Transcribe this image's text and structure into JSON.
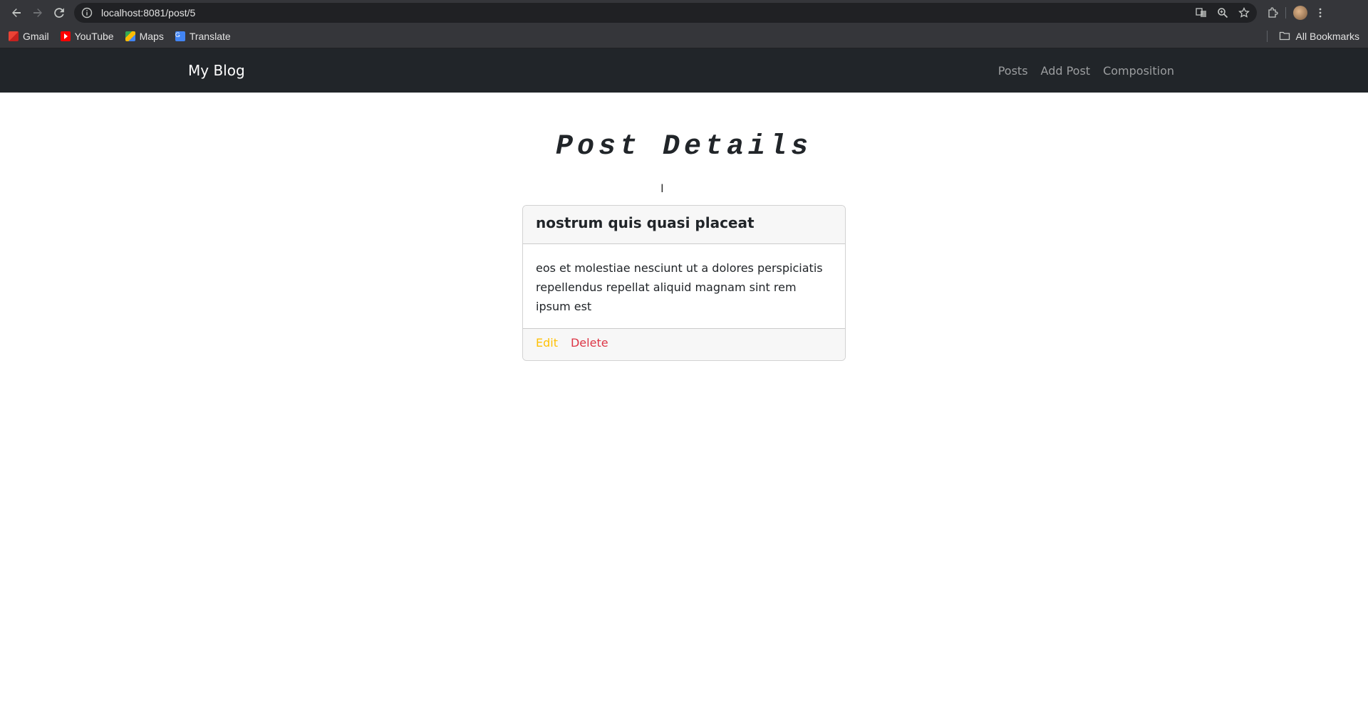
{
  "browser": {
    "url": "localhost:8081/post/5",
    "bookmarks": [
      {
        "label": "Gmail",
        "icon": "gmail-icon"
      },
      {
        "label": "YouTube",
        "icon": "youtube-icon"
      },
      {
        "label": "Maps",
        "icon": "maps-icon"
      },
      {
        "label": "Translate",
        "icon": "translate-icon"
      }
    ],
    "all_bookmarks_label": "All Bookmarks"
  },
  "navbar": {
    "brand": "My Blog",
    "links": [
      "Posts",
      "Add Post",
      "Composition"
    ],
    "background": "#212529"
  },
  "page": {
    "title": "Post Details"
  },
  "post": {
    "title": "nostrum quis quasi placeat",
    "body": "eos et molestiae nesciunt ut a dolores perspiciatis repellendus repellat aliquid magnam sint rem ipsum est",
    "edit_label": "Edit",
    "delete_label": "Delete",
    "edit_color": "#ffc107",
    "delete_color": "#dc3545"
  }
}
